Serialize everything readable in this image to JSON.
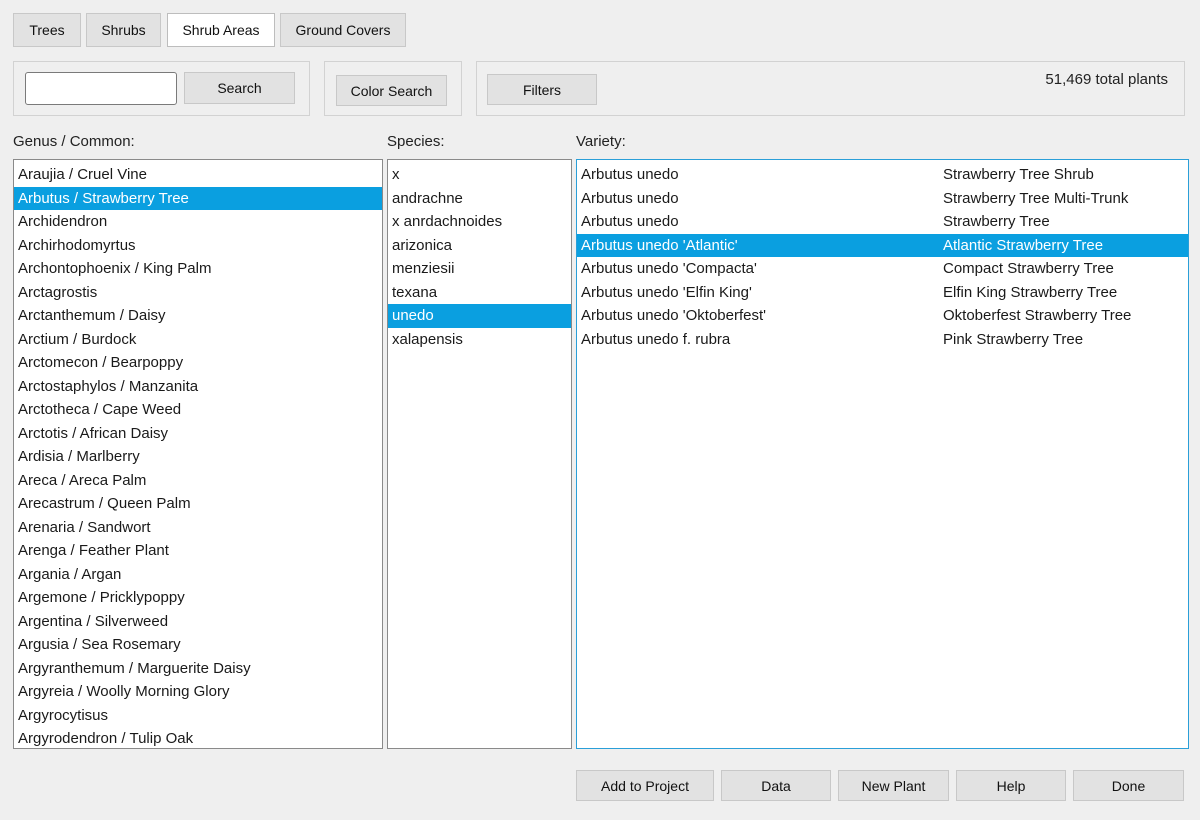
{
  "tabs": [
    {
      "label": "Trees",
      "active": false
    },
    {
      "label": "Shrubs",
      "active": false
    },
    {
      "label": "Shrub Areas",
      "active": true
    },
    {
      "label": "Ground Covers",
      "active": false
    }
  ],
  "search": {
    "value": "",
    "placeholder": "",
    "button_label": "Search"
  },
  "color_search": {
    "button_label": "Color Search"
  },
  "filters": {
    "button_label": "Filters"
  },
  "total_plants": "51,469 total plants",
  "genus": {
    "label": "Genus / Common:",
    "selected_index": 1,
    "items": [
      "Araujia / Cruel Vine",
      "Arbutus / Strawberry Tree",
      "Archidendron",
      "Archirhodomyrtus",
      "Archontophoenix / King Palm",
      "Arctagrostis",
      "Arctanthemum / Daisy",
      "Arctium / Burdock",
      "Arctomecon / Bearpoppy",
      "Arctostaphylos / Manzanita",
      "Arctotheca / Cape Weed",
      "Arctotis / African Daisy",
      "Ardisia / Marlberry",
      "Areca / Areca Palm",
      "Arecastrum / Queen Palm",
      "Arenaria / Sandwort",
      "Arenga / Feather Plant",
      "Argania / Argan",
      "Argemone / Pricklypoppy",
      "Argentina / Silverweed",
      "Argusia / Sea Rosemary",
      "Argyranthemum / Marguerite Daisy",
      "Argyreia / Woolly Morning Glory",
      "Argyrocytisus",
      "Argyrodendron / Tulip Oak"
    ]
  },
  "species": {
    "label": "Species:",
    "selected_index": 6,
    "items": [
      "x",
      "andrachne",
      "x anrdachnoides",
      "arizonica",
      "menziesii",
      "texana",
      "unedo",
      "xalapensis"
    ]
  },
  "variety": {
    "label": "Variety:",
    "selected_index": 3,
    "items": [
      {
        "botanical": "Arbutus unedo",
        "common": "Strawberry Tree Shrub"
      },
      {
        "botanical": "Arbutus unedo",
        "common": "Strawberry Tree Multi-Trunk"
      },
      {
        "botanical": "Arbutus unedo",
        "common": "Strawberry Tree"
      },
      {
        "botanical": "Arbutus unedo 'Atlantic'",
        "common": "Atlantic Strawberry Tree"
      },
      {
        "botanical": "Arbutus unedo 'Compacta'",
        "common": "Compact Strawberry Tree"
      },
      {
        "botanical": "Arbutus unedo 'Elfin King'",
        "common": "Elfin King Strawberry Tree"
      },
      {
        "botanical": "Arbutus unedo 'Oktoberfest'",
        "common": "Oktoberfest Strawberry Tree"
      },
      {
        "botanical": "Arbutus unedo f. rubra",
        "common": "Pink Strawberry Tree"
      }
    ]
  },
  "actions": {
    "add_to_project": "Add to Project",
    "data": "Data",
    "new_plant": "New Plant",
    "help": "Help",
    "done": "Done"
  },
  "colors": {
    "selection": "#0a9fe0",
    "focus_border": "#2a9fd8"
  }
}
